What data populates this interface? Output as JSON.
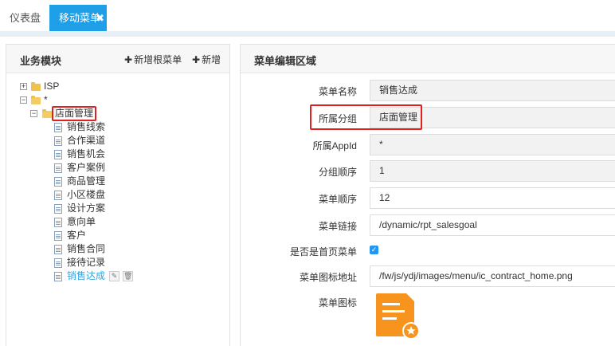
{
  "tabs": {
    "dashboard": "仪表盘",
    "active": "移动菜单",
    "close_glyph": "✖"
  },
  "left_panel": {
    "title": "业务模块",
    "add_root": "新增根菜单",
    "add": "新增",
    "plus": "✚"
  },
  "tree": {
    "toggle_plus": "+",
    "toggle_minus": "−",
    "isp": "ISP",
    "star": "*",
    "group": "店面管理",
    "items": [
      "销售线索",
      "合作渠道",
      "销售机会",
      "客户案例",
      "商品管理",
      "小区楼盘",
      "设计方案",
      "意向单",
      "客户",
      "销售合同",
      "接待记录",
      "销售达成"
    ],
    "edit_glyph": "✎",
    "delete_glyph": "🗑"
  },
  "right_panel": {
    "title": "菜单编辑区域"
  },
  "form": {
    "menu_name_label": "菜单名称",
    "menu_name": "销售达成",
    "group_label": "所属分组",
    "group": "店面管理",
    "appid_label": "所属AppId",
    "appid": "*",
    "group_order_label": "分组顺序",
    "group_order": "1",
    "menu_order_label": "菜单顺序",
    "menu_order": "12",
    "link_label": "菜单链接",
    "link": "/dynamic/rpt_salesgoal",
    "homepage_label": "是否是首页菜单",
    "homepage_checked": true,
    "check_glyph": "✓",
    "icon_url_label": "菜单图标地址",
    "icon_url": "/fw/js/ydj/images/menu/ic_contract_home.png",
    "icon_label": "菜单图标"
  },
  "colors": {
    "accent": "#1e9fe8",
    "selected_text": "#33a3dc",
    "highlight_box": "#e02020",
    "icon_orange": "#f7941d"
  }
}
